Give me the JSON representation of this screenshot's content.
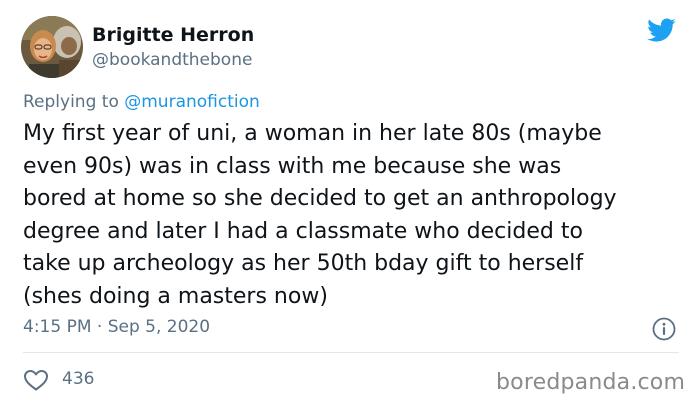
{
  "author": {
    "name": "Brigitte Herron",
    "handle": "@bookandthebone"
  },
  "reply": {
    "prefix": "Replying to ",
    "mention": "@muranofiction"
  },
  "body_lines": [
    "My first year of uni, a woman in her late 80s (maybe",
    "even 90s) was in class with me because she was",
    "bored at home so she decided to get an anthropology",
    "degree and later I had a classmate who decided to",
    "take up archeology as her 50th bday gift to herself",
    "(shes doing a masters now)"
  ],
  "meta": {
    "timestamp": "4:15 PM · Sep 5, 2020"
  },
  "stats": {
    "likes": "436"
  },
  "watermark": "boredpanda.com",
  "icons": {
    "logo": "twitter-bird-icon",
    "info": "info-icon",
    "like": "heart-icon"
  },
  "colors": {
    "text": "#0f1419",
    "secondary": "#5b7083",
    "link": "#1b95e0",
    "twitter_blue": "#1da1f2",
    "divider": "#e1e8ed"
  }
}
